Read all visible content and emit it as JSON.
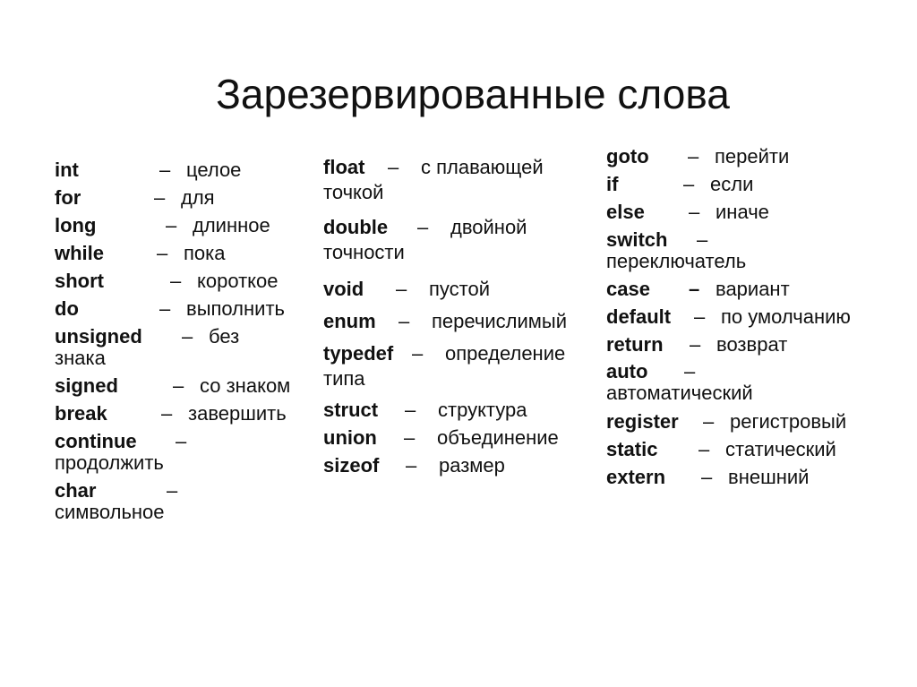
{
  "title": "Зарезервированные слова",
  "columns": [
    {
      "entries": [
        {
          "keyword": "int",
          "dash": "–",
          "definition": "целое"
        },
        {
          "keyword": "for",
          "dash": "–",
          "definition": "для"
        },
        {
          "keyword": "long",
          "dash": "–",
          "definition": "длинное"
        },
        {
          "keyword": "while",
          "dash": "–",
          "definition": "пока"
        },
        {
          "keyword": "short",
          "dash": "–",
          "definition": "короткое"
        },
        {
          "keyword": "do",
          "dash": "–",
          "definition": "выполнить"
        },
        {
          "keyword": "unsigned",
          "dash": "–",
          "definition": "без",
          "continuation": "знака"
        },
        {
          "keyword": "signed",
          "dash": "–",
          "definition": "со знаком"
        },
        {
          "keyword": "break",
          "dash": "–",
          "definition": "завершить"
        },
        {
          "keyword": "continue",
          "dash": "–",
          "definition": "",
          "continuation": "продолжить"
        },
        {
          "keyword": "char",
          "dash": "–",
          "definition": "",
          "continuation": "символьное"
        }
      ]
    },
    {
      "entries": [
        {
          "keyword": "float",
          "dash": "–",
          "definition": "с плавающей",
          "continuation": "точкой"
        },
        {
          "keyword": "double",
          "dash": "–",
          "definition": "двойной",
          "continuation": "точности"
        },
        {
          "keyword": "void",
          "dash": "–",
          "definition": "пустой"
        },
        {
          "keyword": "enum",
          "dash": "–",
          "definition": "перечислимый"
        },
        {
          "keyword": "typedef",
          "dash": "–",
          "definition": "определение",
          "continuation": "типа"
        },
        {
          "keyword": "struct",
          "dash": "–",
          "definition": "структура"
        },
        {
          "keyword": "union",
          "dash": "–",
          "definition": "объединение"
        },
        {
          "keyword": "sizeof",
          "dash": "–",
          "definition": "размер"
        }
      ]
    },
    {
      "entries": [
        {
          "keyword": "goto",
          "dash": "–",
          "definition": "перейти"
        },
        {
          "keyword": "if",
          "dash": "–",
          "definition": "если"
        },
        {
          "keyword": "else",
          "dash": "–",
          "definition": "иначе"
        },
        {
          "keyword": "switch",
          "dash": "–",
          "definition": "",
          "continuation": "переключатель"
        },
        {
          "keyword": "case",
          "dash": "–",
          "definition": "вариант"
        },
        {
          "keyword": "default",
          "dash": "–",
          "definition": "по умолчанию"
        },
        {
          "keyword": "return",
          "dash": "–",
          "definition": "возврат"
        },
        {
          "keyword": "auto",
          "dash": "–",
          "definition": "",
          "continuation": "автоматический"
        },
        {
          "keyword": "register",
          "dash": "–",
          "definition": "регистровый"
        },
        {
          "keyword": "static",
          "dash": "–",
          "definition": "статический"
        },
        {
          "keyword": "extern",
          "dash": "–",
          "definition": "внешний"
        }
      ]
    }
  ]
}
